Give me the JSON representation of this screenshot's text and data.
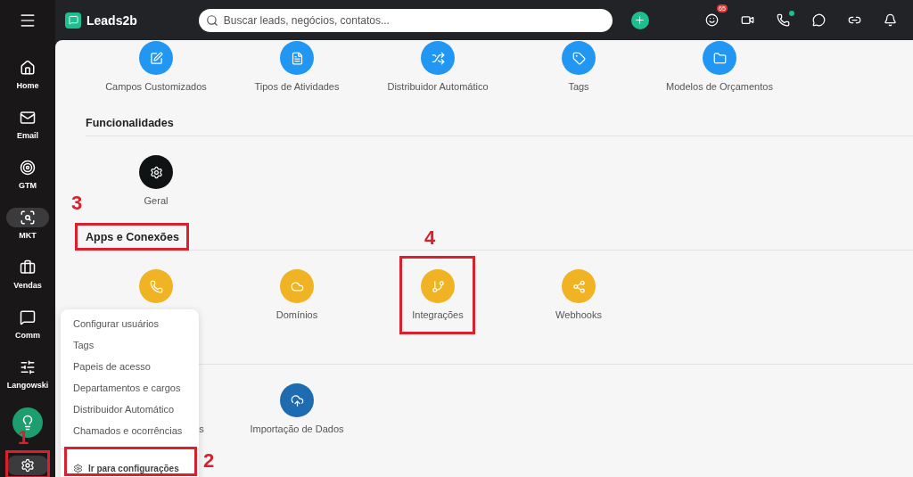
{
  "topbar": {
    "brand": "Leads2b",
    "search": {
      "placeholder": "Buscar leads, negócios, contatos..."
    },
    "badge": "65",
    "phone_online": true
  },
  "sidebar": {
    "items": [
      {
        "label": "Home",
        "selected": false
      },
      {
        "label": "Email",
        "selected": false
      },
      {
        "label": "GTM",
        "selected": false
      },
      {
        "label": "MKT",
        "selected": true
      },
      {
        "label": "Vendas",
        "selected": false
      },
      {
        "label": "Comm",
        "selected": false
      },
      {
        "label": "Langowski",
        "selected": false
      }
    ],
    "settings": {
      "selected": true
    }
  },
  "sections": [
    {
      "items": [
        {
          "label": "Campos Customizados",
          "color": "#2196f3"
        },
        {
          "label": "Tipos de Atividades",
          "color": "#2196f3"
        },
        {
          "label": "Distribuidor Automático",
          "color": "#2196f3"
        },
        {
          "label": "Tags",
          "color": "#2196f3"
        },
        {
          "label": "Modelos de Orçamentos",
          "color": "#2196f3"
        }
      ]
    },
    {
      "title": "Funcionalidades",
      "items": [
        {
          "label": "Geral",
          "color": "#101314"
        }
      ]
    },
    {
      "title": "Apps e Conexões",
      "items": [
        {
          "color": "#f0b323"
        },
        {
          "label": "Domínios",
          "color": "#f0b323"
        },
        {
          "label": "Integrações",
          "color": "#f0b323"
        },
        {
          "label": "Webhooks",
          "color": "#f0b323"
        }
      ]
    },
    {
      "items": [
        {
          "label": "s",
          "clipped": true
        },
        {
          "label": "Importação de Dados",
          "color": "#1f6bb0"
        }
      ]
    }
  ],
  "menu": {
    "items": [
      "Configurar usuários",
      "Tags",
      "Papeis de acesso",
      "Departamentos e cargos",
      "Distribuidor Automático",
      "Chamados e ocorrências"
    ],
    "action": "Ir para configurações"
  },
  "annotations": [
    {
      "number": "1"
    },
    {
      "number": "2"
    },
    {
      "number": "3"
    },
    {
      "number": "4"
    }
  ]
}
